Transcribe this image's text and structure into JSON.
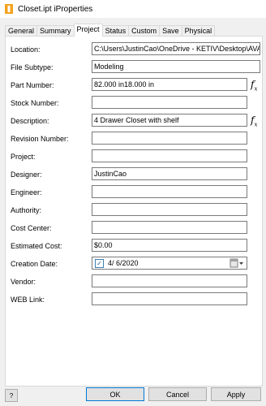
{
  "window": {
    "title": "Closet.ipt iProperties"
  },
  "tabs": [
    {
      "label": "General"
    },
    {
      "label": "Summary"
    },
    {
      "label": "Project"
    },
    {
      "label": "Status"
    },
    {
      "label": "Custom"
    },
    {
      "label": "Save"
    },
    {
      "label": "Physical"
    }
  ],
  "active_tab": "Project",
  "fields": {
    "location": {
      "label": "Location:",
      "value": "C:\\Users\\JustinCao\\OneDrive - KETIV\\Desktop\\AVA\\"
    },
    "file_subtype": {
      "label": "File Subtype:",
      "value": "Modeling"
    },
    "part_number": {
      "label": "Part Number:",
      "value": "82.000 in18.000 in"
    },
    "stock_number": {
      "label": "Stock Number:",
      "value": ""
    },
    "description": {
      "label": "Description:",
      "value": " 4 Drawer Closet with shelf"
    },
    "revision_number": {
      "label": "Revision Number:",
      "value": ""
    },
    "project": {
      "label": "Project:",
      "value": ""
    },
    "designer": {
      "label": "Designer:",
      "value": "JustinCao"
    },
    "engineer": {
      "label": "Engineer:",
      "value": ""
    },
    "authority": {
      "label": "Authority:",
      "value": ""
    },
    "cost_center": {
      "label": "Cost Center:",
      "value": ""
    },
    "estimated_cost": {
      "label": "Estimated Cost:",
      "value": "$0.00"
    },
    "creation_date": {
      "label": "Creation Date:",
      "value": "4/  6/2020",
      "checked": true
    },
    "vendor": {
      "label": "Vendor:",
      "value": ""
    },
    "web_link": {
      "label": "WEB Link:",
      "value": ""
    }
  },
  "fx_glyph": {
    "main": "f",
    "sub": "x"
  },
  "buttons": {
    "ok": "OK",
    "cancel": "Cancel",
    "apply": "Apply",
    "help": "?"
  },
  "icons": {
    "app": "inventor-app-icon",
    "fx": "function-icon",
    "calendar": "calendar-dropdown-icon",
    "help": "help-icon"
  }
}
